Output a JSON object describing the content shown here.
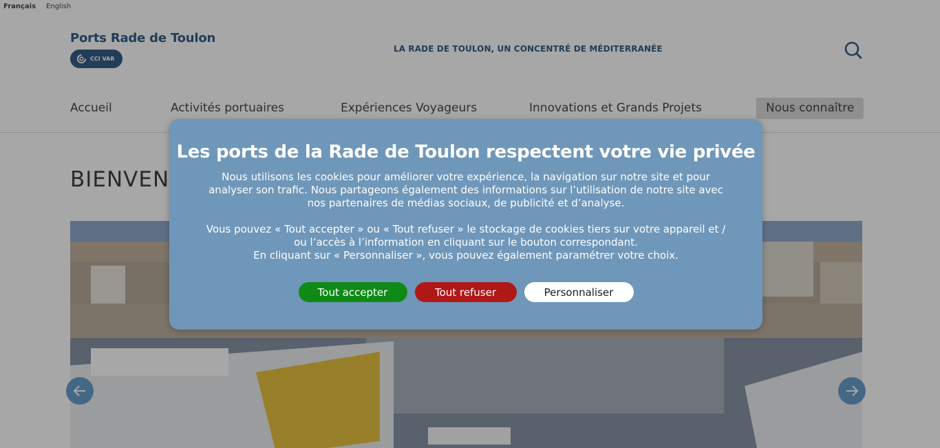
{
  "languages": [
    {
      "label": "Français",
      "active": true
    },
    {
      "label": "English",
      "active": false
    }
  ],
  "header": {
    "brand_title": "Ports Rade de Toulon",
    "badge_label": "CCI VAR",
    "tagline": "LA RADE DE TOULON, UN CONCENTRÉ DE MÉDITERRANÉE",
    "search_icon": "search-icon"
  },
  "nav": {
    "items": [
      {
        "label": "Accueil"
      },
      {
        "label": "Activités portuaires"
      },
      {
        "label": "Expériences Voyageurs"
      },
      {
        "label": "Innovations et Grands Projets"
      },
      {
        "label": "Nous connaître",
        "active": true
      }
    ]
  },
  "main": {
    "welcome_heading": "BIENVENU",
    "hero_icons": {
      "prev": "arrow-left-icon",
      "next": "arrow-right-icon"
    }
  },
  "cookie_modal": {
    "title": "Les ports de la Rade de Toulon respectent votre vie privée",
    "paragraph_1": "Nous utilisons les cookies pour améliorer votre expérience, la navigation sur notre site et pour analyser son trafic. Nous partageons également des informations sur l’utilisation de notre site avec nos partenaires de médias sociaux, de publicité et d’analyse.",
    "paragraph_2_line_1": "Vous pouvez « Tout accepter » ou « Tout refuser » le stockage de cookies tiers sur votre appareil et / ou l’accès à l’information en cliquant sur le bouton correspondant.",
    "paragraph_2_line_2": "En cliquant sur « Personnaliser », vous pouvez également paramétrer votre choix.",
    "buttons": {
      "accept": "Tout accepter",
      "refuse": "Tout refuser",
      "customize": "Personnaliser"
    }
  },
  "colors": {
    "brand_blue": "#0e3f70",
    "modal_bg": "#6f97b9",
    "accept_green": "#0f8a16",
    "refuse_red": "#b01717"
  }
}
